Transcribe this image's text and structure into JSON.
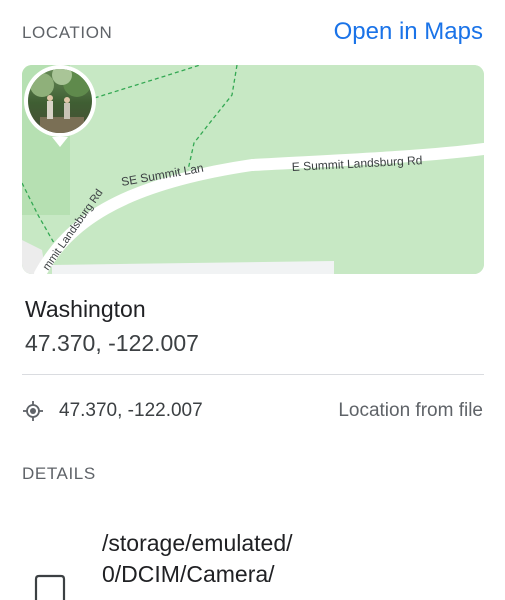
{
  "location": {
    "header": "LOCATION",
    "open_in_maps": "Open in Maps",
    "map": {
      "road_label_left": "SE Summit Lan",
      "road_label_right": "E Summit Landsburg Rd",
      "road_label_diagonal": "mmit Landsburg Rd"
    },
    "place_name": "Washington",
    "coords": "47.370, -122.007",
    "source_row": {
      "icon": "gps-icon",
      "coords": "47.370, -122.007",
      "source": "Location from file"
    }
  },
  "details": {
    "header": "DETAILS",
    "file_icon": "file-icon",
    "path_line1": "/storage/emulated/",
    "path_line2": "0/DCIM/Camera/"
  }
}
